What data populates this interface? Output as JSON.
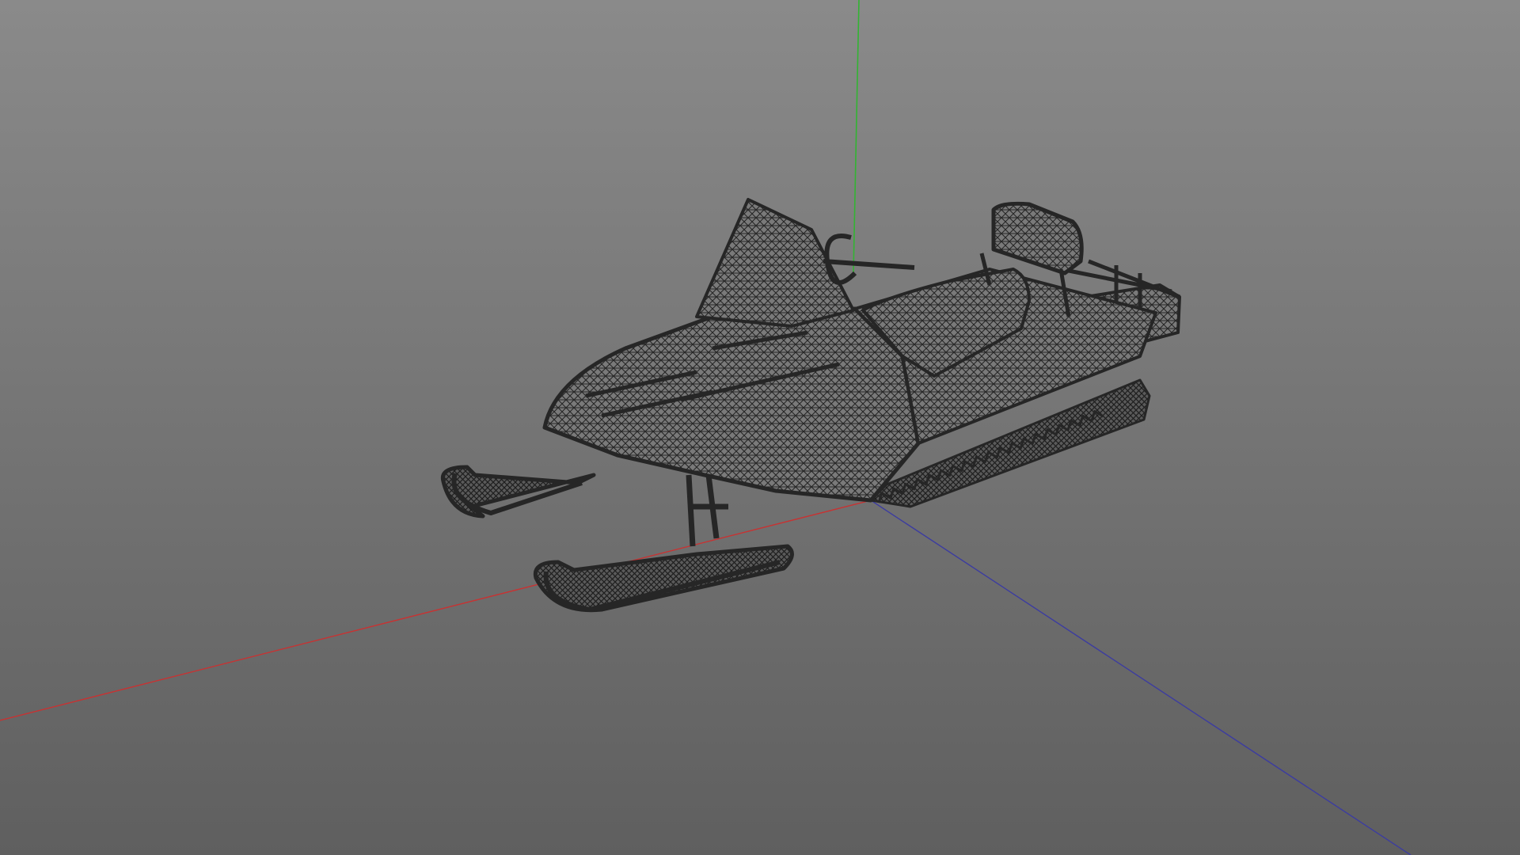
{
  "viewport": {
    "name": "3D viewport",
    "shading_mode": "wireframe",
    "background_top": "#8a8a8a",
    "background_bottom": "#5f5f5f"
  },
  "axes": {
    "x_color": "#c83232",
    "y_color": "#32b432",
    "z_color": "#3c3ca0"
  },
  "model": {
    "subject": "snowmobile",
    "wire_color": "#262626"
  }
}
